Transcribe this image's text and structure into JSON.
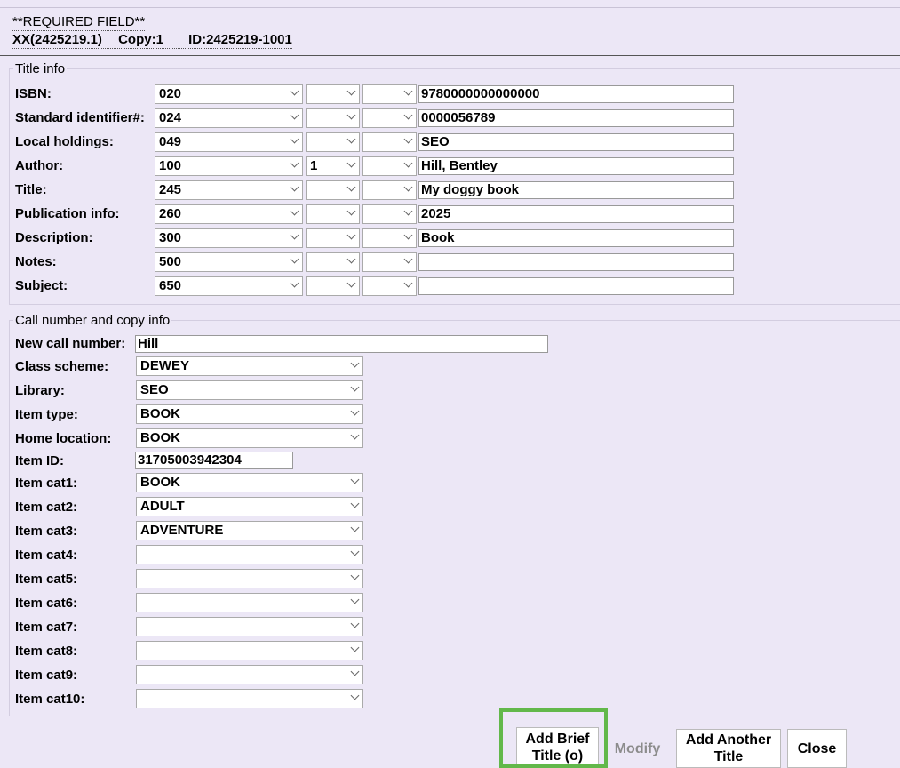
{
  "header": {
    "required_field": "**REQUIRED FIELD**",
    "record_id": "XX(2425219.1)",
    "copy": "Copy:1",
    "item_id": "ID:2425219-1001"
  },
  "title_info": {
    "legend": "Title info",
    "rows": [
      {
        "label": "ISBN:",
        "tag": "020",
        "ind1": "",
        "ind2": "",
        "value": "9780000000000000"
      },
      {
        "label": "Standard identifier#:",
        "tag": "024",
        "ind1": "",
        "ind2": "",
        "value": "0000056789"
      },
      {
        "label": "Local holdings:",
        "tag": "049",
        "ind1": "",
        "ind2": "",
        "value": "SEO"
      },
      {
        "label": "Author:",
        "tag": "100",
        "ind1": "1",
        "ind2": "",
        "value": "Hill, Bentley"
      },
      {
        "label": "Title:",
        "tag": "245",
        "ind1": "",
        "ind2": "",
        "value": "My doggy book"
      },
      {
        "label": "Publication info:",
        "tag": "260",
        "ind1": "",
        "ind2": "",
        "value": "2025"
      },
      {
        "label": "Description:",
        "tag": "300",
        "ind1": "",
        "ind2": "",
        "value": "Book"
      },
      {
        "label": "Notes:",
        "tag": "500",
        "ind1": "",
        "ind2": "",
        "value": ""
      },
      {
        "label": "Subject:",
        "tag": "650",
        "ind1": "",
        "ind2": "",
        "value": ""
      }
    ]
  },
  "call_info": {
    "legend": "Call number and copy info",
    "new_call_number": {
      "label": "New call number:",
      "value": "Hill"
    },
    "class_scheme": {
      "label": "Class scheme:",
      "value": "DEWEY"
    },
    "library": {
      "label": "Library:",
      "value": "SEO"
    },
    "item_type": {
      "label": "Item type:",
      "value": "BOOK"
    },
    "home_location": {
      "label": "Home location:",
      "value": "BOOK"
    },
    "item_id": {
      "label": "Item ID:",
      "value": "31705003942304"
    },
    "item_cats": [
      {
        "label": "Item cat1:",
        "value": "BOOK"
      },
      {
        "label": "Item cat2:",
        "value": "ADULT"
      },
      {
        "label": "Item cat3:",
        "value": "ADVENTURE"
      },
      {
        "label": "Item cat4:",
        "value": ""
      },
      {
        "label": "Item cat5:",
        "value": ""
      },
      {
        "label": "Item cat6:",
        "value": ""
      },
      {
        "label": "Item cat7:",
        "value": ""
      },
      {
        "label": "Item cat8:",
        "value": ""
      },
      {
        "label": "Item cat9:",
        "value": ""
      },
      {
        "label": "Item cat10:",
        "value": ""
      }
    ]
  },
  "buttons": {
    "add_brief_title_line1": "Add Brief",
    "add_brief_title_line2": "Title (o)",
    "modify": "Modify",
    "add_another_title_line1": "Add Another",
    "add_another_title_line2": "Title",
    "close": "Close"
  },
  "colors": {
    "background": "#ece7f6",
    "focus_ring": "#62b84a"
  }
}
